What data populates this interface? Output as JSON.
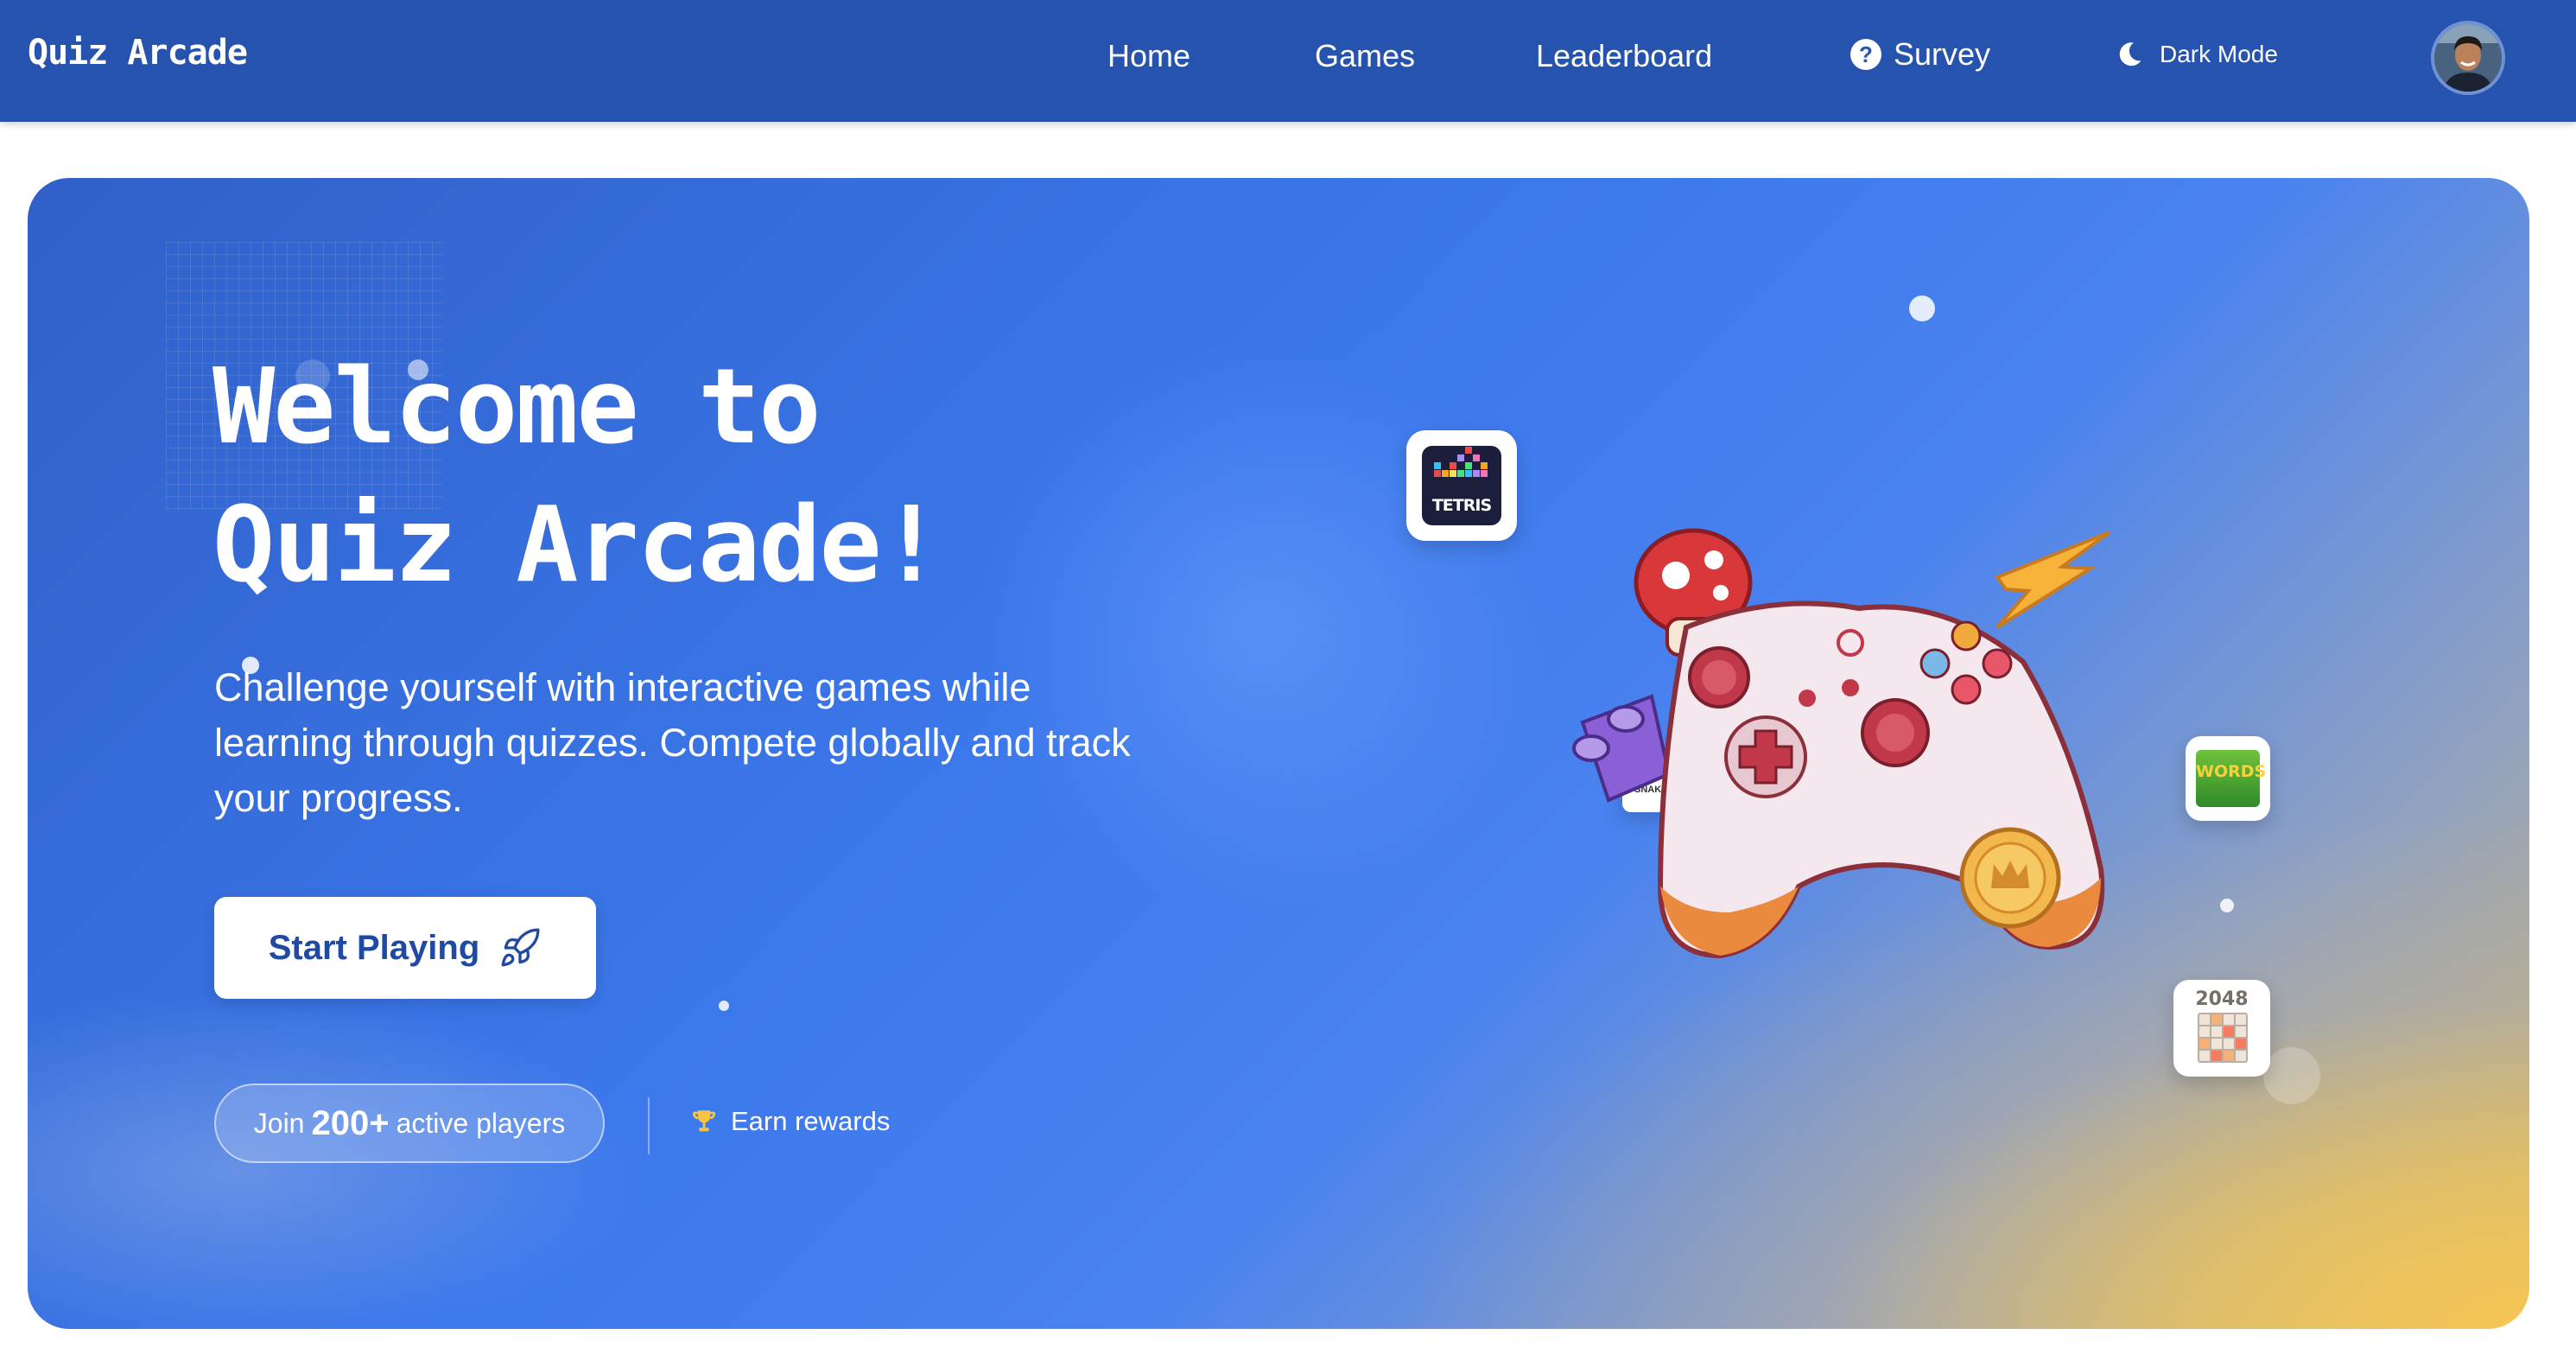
{
  "navbar": {
    "brand": "Quiz Arcade",
    "links": [
      {
        "label": "Home"
      },
      {
        "label": "Games"
      },
      {
        "label": "Leaderboard"
      },
      {
        "label": "Survey",
        "icon": "help-circle-icon"
      }
    ],
    "dark_mode_label": "Dark Mode",
    "dark_mode_icon": "moon-icon",
    "avatar_icon": "user-avatar"
  },
  "hero": {
    "title_line1": "Welcome to",
    "title_line2": "Quiz Arcade!",
    "subtitle": "Challenge yourself with interactive games while learning through quizzes. Compete globally and track your progress.",
    "cta_label": "Start Playing",
    "cta_icon": "rocket-icon",
    "players_prefix": "Join",
    "players_count": "200+",
    "players_suffix": "active players",
    "rewards_label": "Earn rewards",
    "rewards_icon": "trophy-icon",
    "game_cards": {
      "tetris": "TETRIS",
      "words": "WORDS",
      "snake": "SNAKE",
      "game_2048": "2048"
    }
  },
  "colors": {
    "navbar": "#2553ad",
    "accent": "#1f4aa3",
    "hero_start": "#3060c8",
    "hero_end": "#f5c653"
  }
}
